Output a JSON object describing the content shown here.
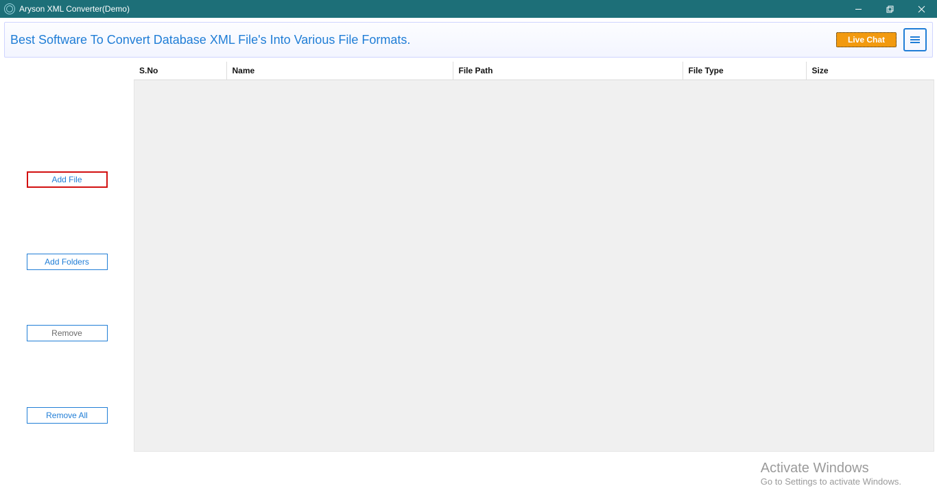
{
  "window": {
    "title": "Aryson XML Converter(Demo)"
  },
  "banner": {
    "tagline": "Best Software To Convert Database XML File's Into Various File Formats.",
    "live_chat": "Live Chat"
  },
  "sidebar": {
    "add_file": "Add File",
    "add_folders": "Add Folders",
    "remove": "Remove",
    "remove_all": "Remove All"
  },
  "table": {
    "columns": {
      "sno": "S.No",
      "name": "Name",
      "file_path": "File Path",
      "file_type": "File Type",
      "size": "Size"
    },
    "rows": []
  },
  "watermark": {
    "line1": "Activate Windows",
    "line2": "Go to Settings to activate Windows."
  }
}
